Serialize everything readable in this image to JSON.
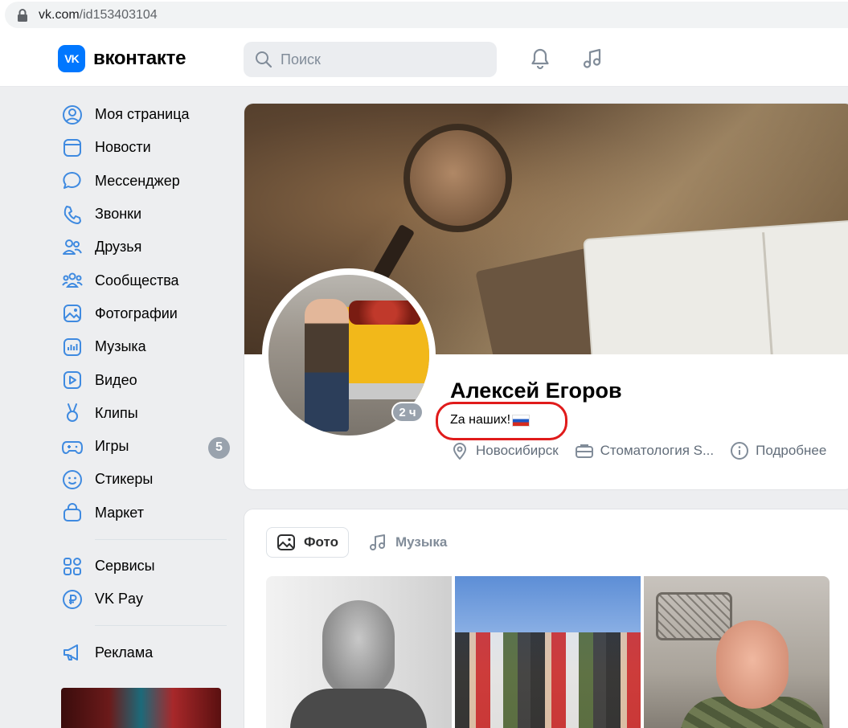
{
  "browser": {
    "url_domain": "vk.com",
    "url_path": "/id153403104"
  },
  "header": {
    "logo_mark": "VK",
    "logo_text": "вконтакте",
    "search_placeholder": "Поиск"
  },
  "sidebar": {
    "items": [
      {
        "label": "Моя страница",
        "icon": "user-circle-icon"
      },
      {
        "label": "Новости",
        "icon": "newsfeed-icon"
      },
      {
        "label": "Мессенджер",
        "icon": "message-icon"
      },
      {
        "label": "Звонки",
        "icon": "phone-icon"
      },
      {
        "label": "Друзья",
        "icon": "friends-icon"
      },
      {
        "label": "Сообщества",
        "icon": "communities-icon"
      },
      {
        "label": "Фотографии",
        "icon": "photo-icon"
      },
      {
        "label": "Музыка",
        "icon": "music-icon"
      },
      {
        "label": "Видео",
        "icon": "video-icon"
      },
      {
        "label": "Клипы",
        "icon": "clips-icon"
      },
      {
        "label": "Игры",
        "icon": "gamepad-icon",
        "badge": "5"
      },
      {
        "label": "Стикеры",
        "icon": "smile-icon"
      },
      {
        "label": "Маркет",
        "icon": "bag-icon"
      }
    ],
    "secondary": [
      {
        "label": "Сервисы",
        "icon": "services-icon"
      },
      {
        "label": "VK Pay",
        "icon": "vkpay-icon"
      }
    ],
    "tertiary": [
      {
        "label": "Реклама",
        "icon": "megaphone-icon"
      }
    ]
  },
  "profile": {
    "name": "Алексей Егоров",
    "status": "Za наших!",
    "online_ago": "2 ч",
    "city": "Новосибирск",
    "work": "Стоматология S...",
    "more": "Подробнее",
    "highlight_color": "#e01b1b"
  },
  "media": {
    "tabs": [
      {
        "label": "Фото",
        "active": true
      },
      {
        "label": "Музыка",
        "active": false
      }
    ]
  },
  "colors": {
    "accent": "#0077ff",
    "badge": "#99a2ad",
    "bg": "#edeef0"
  }
}
